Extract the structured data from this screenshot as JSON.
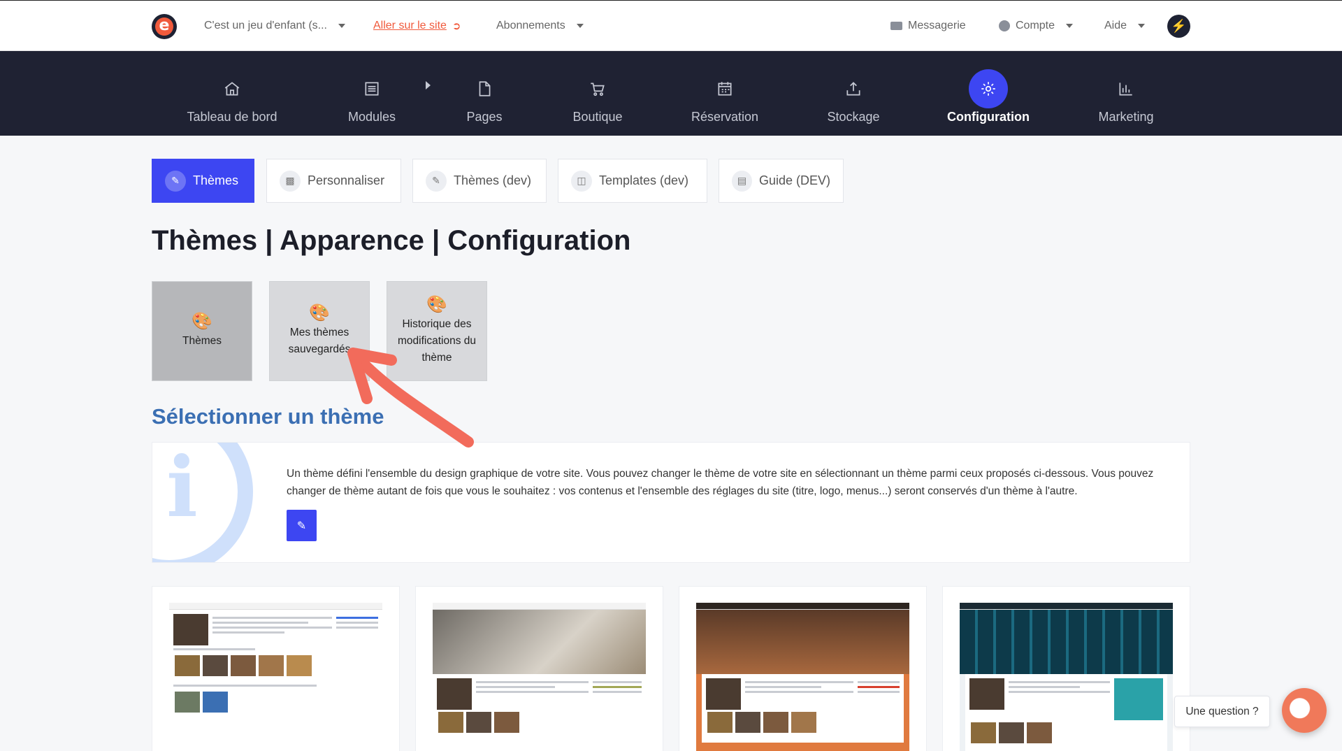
{
  "topbar": {
    "site_selector": "C'est un jeu d'enfant (s...",
    "visit_site": "Aller sur le site",
    "subscriptions": "Abonnements",
    "messaging": "Messagerie",
    "account": "Compte",
    "help": "Aide"
  },
  "nav": {
    "items": [
      {
        "label": "Tableau de bord",
        "icon": "home-icon"
      },
      {
        "label": "Modules",
        "icon": "list-icon"
      },
      {
        "label": "Pages",
        "icon": "file-icon"
      },
      {
        "label": "Boutique",
        "icon": "cart-icon"
      },
      {
        "label": "Réservation",
        "icon": "calendar-icon"
      },
      {
        "label": "Stockage",
        "icon": "upload-icon"
      },
      {
        "label": "Configuration",
        "icon": "gear-icon"
      },
      {
        "label": "Marketing",
        "icon": "bar-chart-icon"
      }
    ],
    "active": "Configuration"
  },
  "subtabs": [
    {
      "label": "Thèmes"
    },
    {
      "label": "Personnaliser"
    },
    {
      "label": "Thèmes (dev)"
    },
    {
      "label": "Templates (dev)"
    },
    {
      "label": "Guide (DEV)"
    }
  ],
  "page_title": "Thèmes | Apparence | Configuration",
  "tiles": [
    {
      "label": "Thèmes"
    },
    {
      "label": "Mes thèmes sauvegardés"
    },
    {
      "label": "Historique des modifications du thème"
    }
  ],
  "section_title": "Sélectionner un thème",
  "info_text": "Un thème défini l'ensemble du design graphique de votre site. Vous pouvez changer le thème de votre site en sélectionnant un thème parmi ceux proposés ci-dessous. Vous pouvez changer de thème autant de fois que vous le souhaitez : vos contenus et l'ensemble des réglages du site (titre, logo, menus...) seront conservés d'un thème à l'autre.",
  "help_label": "Une question ?",
  "colors": {
    "accent": "#3d46f2",
    "nav_bg": "#1f2233",
    "brand_orange": "#f05a3c",
    "section_title": "#3b6fb3",
    "annotation": "#f26b5b"
  }
}
